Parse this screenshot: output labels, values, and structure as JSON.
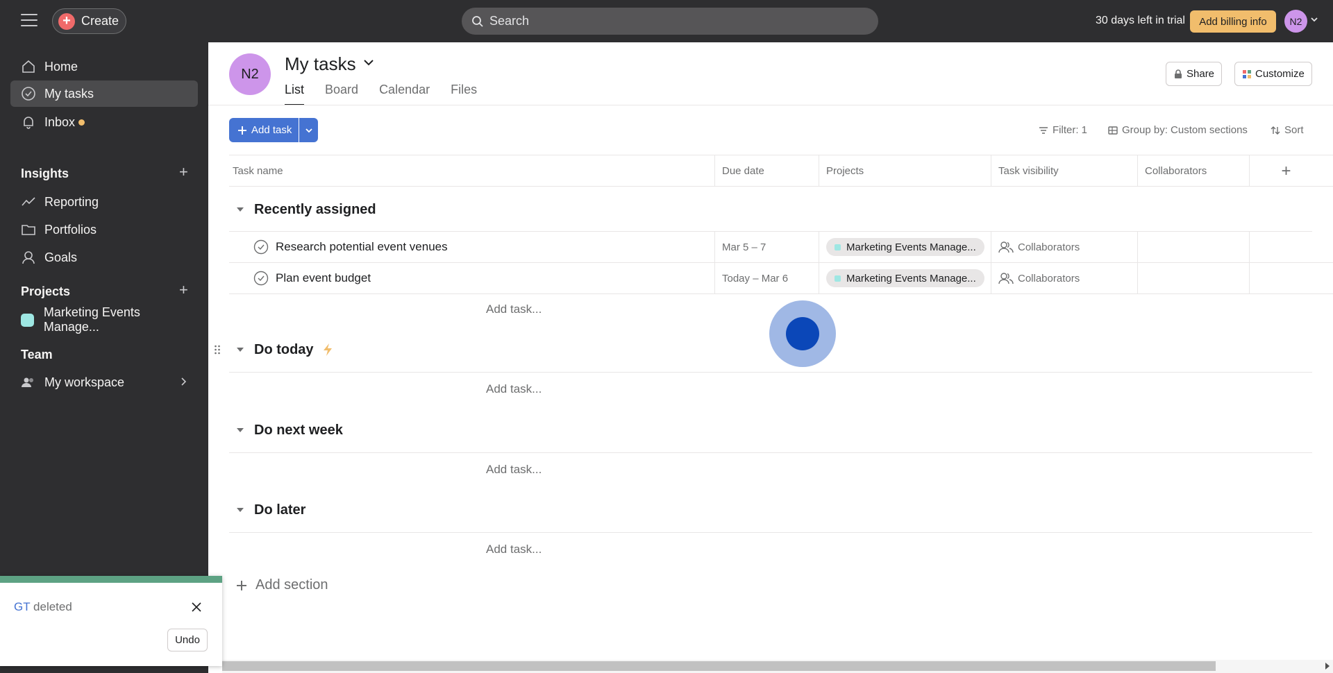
{
  "topbar": {
    "create_label": "Create",
    "search_placeholder": "Search",
    "trial_text": "30 days left in trial",
    "billing_label": "Add billing info",
    "avatar_initials": "N2"
  },
  "sidebar": {
    "nav": [
      {
        "label": "Home",
        "icon": "home-icon"
      },
      {
        "label": "My tasks",
        "icon": "check-circle-icon"
      },
      {
        "label": "Inbox",
        "icon": "bell-icon"
      }
    ],
    "insights": {
      "title": "Insights",
      "items": [
        {
          "label": "Reporting",
          "icon": "reporting-icon"
        },
        {
          "label": "Portfolios",
          "icon": "folder-icon"
        },
        {
          "label": "Goals",
          "icon": "goals-icon"
        }
      ]
    },
    "projects": {
      "title": "Projects",
      "items": [
        {
          "label": "Marketing Events Manage...",
          "color": "#9ee7e3"
        }
      ]
    },
    "team": {
      "title": "Team",
      "items": [
        {
          "label": "My workspace",
          "icon": "people-icon"
        }
      ]
    }
  },
  "toast": {
    "link_text": "GT",
    "message": " deleted",
    "undo_label": "Undo"
  },
  "page": {
    "avatar_initials": "N2",
    "title": "My tasks",
    "tabs": [
      "List",
      "Board",
      "Calendar",
      "Files"
    ],
    "active_tab": "List",
    "share_label": "Share",
    "customize_label": "Customize",
    "add_task_label": "Add task",
    "filter_label": "Filter: 1",
    "group_by_label": "Group by: Custom sections",
    "sort_label": "Sort"
  },
  "columns": [
    "Task name",
    "Due date",
    "Projects",
    "Task visibility",
    "Collaborators"
  ],
  "sections": [
    {
      "title": "Recently assigned",
      "tasks": [
        {
          "name": "Research potential event venues",
          "due": "Mar 5 – 7",
          "project": "Marketing Events Manage...",
          "visibility": "Collaborators"
        },
        {
          "name": "Plan event budget",
          "due": "Today – Mar 6",
          "project": "Marketing Events Manage...",
          "visibility": "Collaborators"
        }
      ],
      "add_task": "Add task..."
    },
    {
      "title": "Do today",
      "tasks": [],
      "add_task": "Add task..."
    },
    {
      "title": "Do next week",
      "tasks": [],
      "add_task": "Add task..."
    },
    {
      "title": "Do later",
      "tasks": [],
      "add_task": "Add task..."
    }
  ],
  "add_section_label": "Add section",
  "colors": {
    "topbar_bg": "#2e2e30",
    "accent_blue": "#4573d2",
    "billing_yellow": "#f1bd6c",
    "avatar_purple": "#cd95ea",
    "toast_green": "#5da283",
    "create_red": "#f06a6a"
  }
}
